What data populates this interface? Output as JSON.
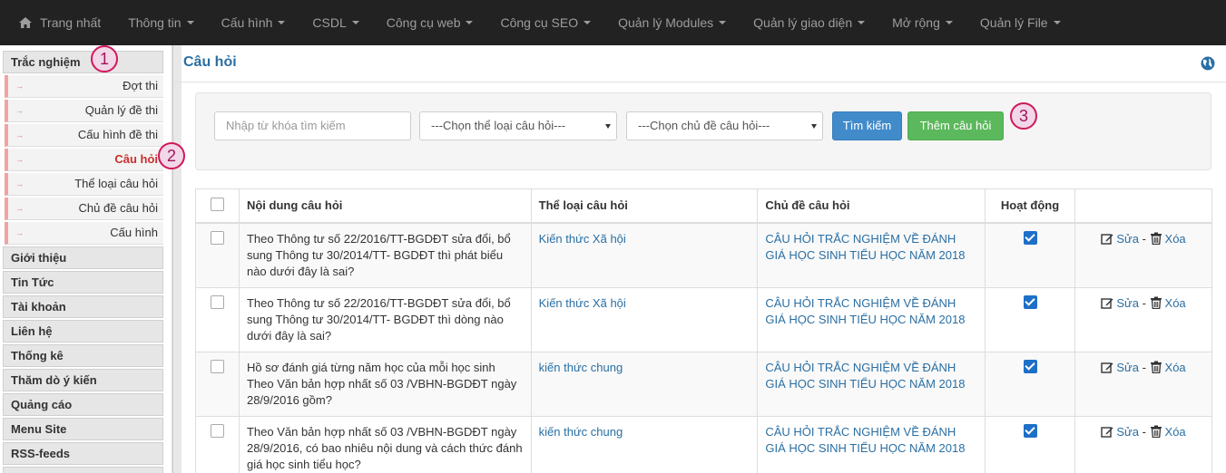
{
  "topnav": {
    "items": [
      {
        "label": "Trang nhất",
        "has_caret": false,
        "icon": "home-icon"
      },
      {
        "label": "Thông tin",
        "has_caret": true
      },
      {
        "label": "Cấu hình",
        "has_caret": true
      },
      {
        "label": "CSDL",
        "has_caret": true
      },
      {
        "label": "Công cụ web",
        "has_caret": true
      },
      {
        "label": "Công cụ SEO",
        "has_caret": true
      },
      {
        "label": "Quản lý Modules",
        "has_caret": true
      },
      {
        "label": "Quản lý giao diện",
        "has_caret": true
      },
      {
        "label": "Mở rộng",
        "has_caret": true
      },
      {
        "label": "Quản lý File",
        "has_caret": true
      }
    ]
  },
  "sidebar": {
    "module": "Trắc nghiệm",
    "subitems": [
      "Đợt thi",
      "Quản lý đề thi",
      "Cấu hình đề thi",
      "Câu hỏi",
      "Thể loại câu hỏi",
      "Chủ đề câu hỏi",
      "Cấu hình"
    ],
    "active_subitem": "Câu hỏi",
    "groups": [
      "Giới thiệu",
      "Tin Tức",
      "Tài khoản",
      "Liên hệ",
      "Thống kê",
      "Thăm dò ý kiến",
      "Quảng cáo",
      "Menu Site",
      "RSS-feeds"
    ]
  },
  "annotations": [
    "1",
    "2",
    "3"
  ],
  "main": {
    "title": "Câu hỏi",
    "search": {
      "placeholder": "Nhập từ khóa tìm kiếm"
    },
    "category_select": "---Chọn thể loại câu hỏi---",
    "topic_select": "---Chọn chủ đề câu hỏi---",
    "search_button": "Tìm kiếm",
    "add_button": "Thêm câu hỏi",
    "table": {
      "headers": [
        "Nội dung câu hỏi",
        "Thể loại câu hỏi",
        "Chủ đề câu hỏi",
        "Hoạt động",
        ""
      ],
      "edit_label": "Sửa",
      "separator": "-",
      "delete_label": "Xóa",
      "rows": [
        {
          "content": "Theo Thông tư số 22/2016/TT-BGDĐT sửa đổi, bổ sung Thông tư 30/2014/TT- BGDĐT thì phát biểu nào dưới đây là sai?",
          "category": "Kiến thức Xã hội",
          "topic": "CÂU HỎI TRẮC NGHIỆM VỀ ĐÁNH GIÁ HỌC SINH TIỂU HỌC NĂM 2018",
          "active": true
        },
        {
          "content": "Theo Thông tư số 22/2016/TT-BGDĐT sửa đổi, bổ sung Thông tư 30/2014/TT- BGDĐT thì dòng nào dưới đây là sai?",
          "category": "Kiến thức Xã hội",
          "topic": "CÂU HỎI TRẮC NGHIỆM VỀ ĐÁNH GIÁ HỌC SINH TIỂU HỌC NĂM 2018",
          "active": true
        },
        {
          "content": "Hồ sơ đánh giá từng năm học của mỗi học sinh Theo Văn bản hợp nhất số 03 /VBHN-BGDĐT ngày 28/9/2016 gồm?",
          "category": "kiến thức chung",
          "topic": "CÂU HỎI TRẮC NGHIỆM VỀ ĐÁNH GIÁ HỌC SINH TIỂU HỌC NĂM 2018",
          "active": true
        },
        {
          "content": "Theo Văn bản hợp nhất số 03 /VBHN-BGDĐT ngày 28/9/2016, có bao nhiêu nội dung và cách thức đánh giá học sinh tiểu học?",
          "category": "kiến thức chung",
          "topic": "CÂU HỎI TRẮC NGHIỆM VỀ ĐÁNH GIÁ HỌC SINH TIỂU HỌC NĂM 2018",
          "active": true
        }
      ]
    }
  },
  "colors": {
    "navbar": "#222222",
    "link": "#2a6fa3",
    "primary": "#428bca",
    "success": "#5cb85c",
    "active": "#c9302c",
    "badge": "#d0185a"
  }
}
